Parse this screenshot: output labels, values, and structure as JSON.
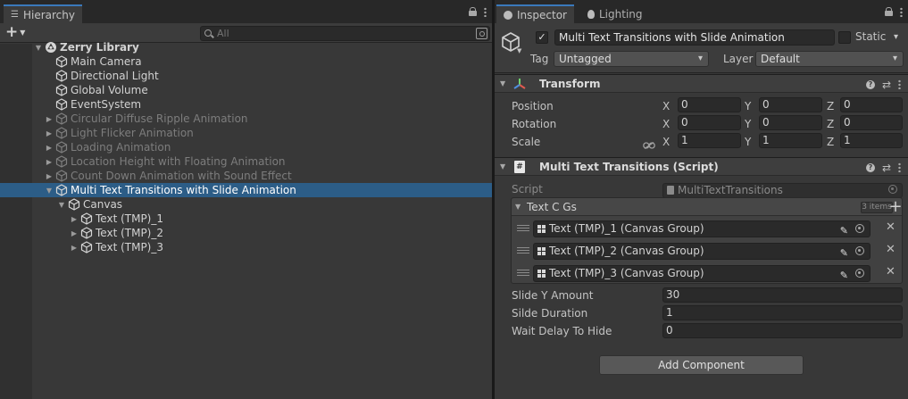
{
  "hierarchy": {
    "tab_label": "Hierarchy",
    "search_placeholder": "All",
    "items": [
      {
        "label": "Zerry Library",
        "kind": "scene",
        "depth": 0,
        "expanded": true,
        "dim": false
      },
      {
        "label": "Main Camera",
        "kind": "object",
        "depth": 1,
        "dim": false
      },
      {
        "label": "Directional Light",
        "kind": "object",
        "depth": 1,
        "dim": false
      },
      {
        "label": "Global Volume",
        "kind": "object",
        "depth": 1,
        "dim": false
      },
      {
        "label": "EventSystem",
        "kind": "object",
        "depth": 1,
        "dim": false
      },
      {
        "label": "Circular Diffuse Ripple Animation",
        "kind": "object",
        "depth": 1,
        "foldout": "collapsed",
        "dim": true
      },
      {
        "label": "Light Flicker Animation",
        "kind": "object",
        "depth": 1,
        "foldout": "collapsed",
        "dim": true
      },
      {
        "label": "Loading Animation",
        "kind": "object",
        "depth": 1,
        "foldout": "collapsed",
        "dim": true
      },
      {
        "label": "Location Height with Floating Animation",
        "kind": "object",
        "depth": 1,
        "foldout": "collapsed",
        "dim": true
      },
      {
        "label": "Count Down Animation with Sound Effect",
        "kind": "object",
        "depth": 1,
        "foldout": "collapsed",
        "dim": true
      },
      {
        "label": "Multi Text Transitions with Slide Animation",
        "kind": "object",
        "depth": 1,
        "foldout": "expanded",
        "dim": false,
        "selected": true
      },
      {
        "label": "Canvas",
        "kind": "object",
        "depth": 2,
        "foldout": "expanded",
        "dim": false
      },
      {
        "label": "Text (TMP)_1",
        "kind": "object",
        "depth": 3,
        "foldout": "collapsed",
        "dim": false
      },
      {
        "label": "Text (TMP)_2",
        "kind": "object",
        "depth": 3,
        "foldout": "collapsed",
        "dim": false
      },
      {
        "label": "Text (TMP)_3",
        "kind": "object",
        "depth": 3,
        "foldout": "collapsed",
        "dim": false
      }
    ]
  },
  "inspector": {
    "tab_label": "Inspector",
    "lighting_tab_label": "Lighting",
    "object_name": "Multi Text Transitions with Slide Animation",
    "active_check": "✓",
    "static_label": "Static",
    "tag_label": "Tag",
    "tag_value": "Untagged",
    "layer_label": "Layer",
    "layer_value": "Default",
    "transform": {
      "title": "Transform",
      "axis_x": "X",
      "axis_y": "Y",
      "axis_z": "Z",
      "position": {
        "label": "Position",
        "x": "0",
        "y": "0",
        "z": "0"
      },
      "rotation": {
        "label": "Rotation",
        "x": "0",
        "y": "0",
        "z": "0"
      },
      "scale": {
        "label": "Scale",
        "x": "1",
        "y": "1",
        "z": "1"
      }
    },
    "script_component": {
      "title": "Multi Text Transitions (Script)",
      "script_label": "Script",
      "script_value": "MultiTextTransitions",
      "list_title": "Text C Gs",
      "list_count": "3 items",
      "list_items": [
        "Text (TMP)_1 (Canvas Group)",
        "Text (TMP)_2 (Canvas Group)",
        "Text (TMP)_3 (Canvas Group)"
      ],
      "slide_y_label": "Slide Y Amount",
      "slide_y_value": "30",
      "slide_duration_label": "Silde Duration",
      "slide_duration_value": "1",
      "wait_delay_label": "Wait Delay To Hide",
      "wait_delay_value": "0"
    },
    "add_component_label": "Add Component"
  },
  "colors": {
    "panel_bg": "#383838",
    "selection": "#2c5d87",
    "tab_accent": "#3a79bb",
    "field_bg": "#2a2a2a"
  }
}
